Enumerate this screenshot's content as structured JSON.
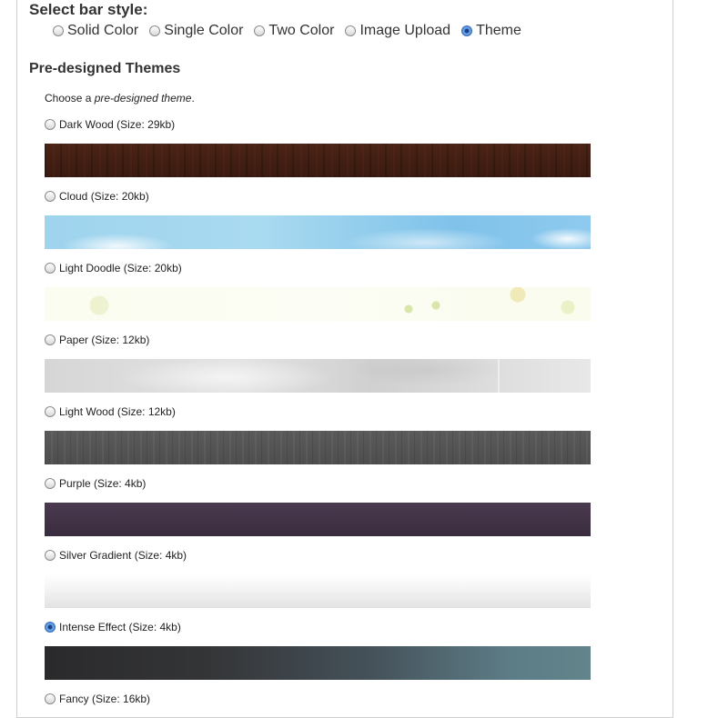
{
  "bar_style": {
    "title": "Select bar style:",
    "options": [
      {
        "label": "Solid Color",
        "checked": false
      },
      {
        "label": "Single Color",
        "checked": false
      },
      {
        "label": "Two Color",
        "checked": false
      },
      {
        "label": "Image Upload",
        "checked": false
      },
      {
        "label": "Theme",
        "checked": true
      }
    ]
  },
  "themes": {
    "title": "Pre-designed Themes",
    "intro_prefix": "Choose a ",
    "intro_em": "pre-designed theme",
    "intro_suffix": ".",
    "items": [
      {
        "label": "Dark Wood (Size: 29kb)",
        "checked": false
      },
      {
        "label": "Cloud (Size: 20kb)",
        "checked": false
      },
      {
        "label": "Light Doodle (Size: 20kb)",
        "checked": false
      },
      {
        "label": "Paper (Size: 12kb)",
        "checked": false
      },
      {
        "label": "Light Wood (Size: 12kb)",
        "checked": false
      },
      {
        "label": "Purple (Size: 4kb)",
        "checked": false
      },
      {
        "label": "Silver Gradient (Size: 4kb)",
        "checked": false
      },
      {
        "label": "Intense Effect (Size: 4kb)",
        "checked": true
      },
      {
        "label": "Fancy (Size: 16kb)",
        "checked": false
      }
    ]
  }
}
